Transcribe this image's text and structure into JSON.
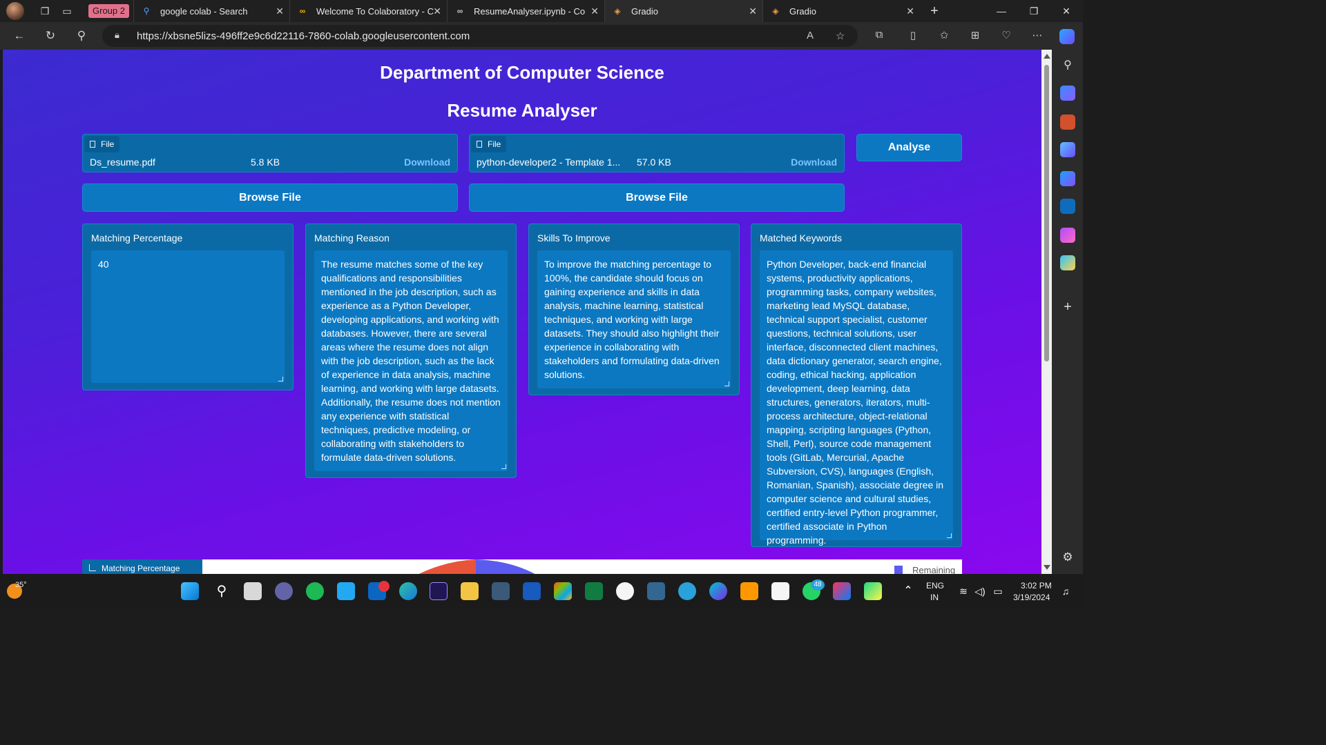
{
  "browser": {
    "tab_group": "Group 2",
    "tabs": [
      {
        "title": "google colab - Search",
        "icon": "search-icon"
      },
      {
        "title": "Welcome To Colaboratory - C",
        "icon": "colab-icon"
      },
      {
        "title": "ResumeAnalyser.ipynb - Colab",
        "icon": "colab-icon"
      },
      {
        "title": "Gradio",
        "icon": "gradio-icon",
        "active": true
      },
      {
        "title": "Gradio",
        "icon": "gradio-icon"
      }
    ],
    "url": "https://xbsne5lizs-496ff2e9c6d22116-7860-colab.googleusercontent.com"
  },
  "app": {
    "title": "Department of Computer Science",
    "subtitle": "Resume Analyser",
    "files": [
      {
        "chip": "File",
        "name": "Ds_resume.pdf",
        "size": "5.8 KB",
        "download": "Download"
      },
      {
        "chip": "File",
        "name": "python-developer2 - Template 1...",
        "size": "57.0 KB",
        "download": "Download"
      }
    ],
    "browse_label": "Browse File",
    "analyse_label": "Analyse",
    "panels": [
      {
        "label": "Matching Percentage",
        "value": "40"
      },
      {
        "label": "Matching Reason",
        "value": "The resume matches some of the key qualifications and responsibilities mentioned in the job description, such as experience as a Python Developer, developing applications, and working with databases. However, there are several areas where the resume does not align with the job description, such as the lack of experience in data analysis, machine learning, and working with large datasets. Additionally, the resume does not mention any experience with statistical techniques, predictive modeling, or collaborating with stakeholders to formulate data-driven solutions."
      },
      {
        "label": "Skills To Improve",
        "value": "To improve the matching percentage to 100%, the candidate should focus on gaining experience and skills in data analysis, machine learning, statistical techniques, and working with large datasets. They should also highlight their experience in collaborating with stakeholders and formulating data-driven solutions."
      },
      {
        "label": "Matched Keywords",
        "value": "Python Developer, back-end financial systems, productivity applications, programming tasks, company websites, marketing lead MySQL database, technical support specialist, customer questions, technical solutions, user interface, disconnected client machines, data dictionary generator, search engine, coding, ethical hacking, application development, deep learning, data structures, generators, iterators, multi-process architecture, object-relational mapping, scripting languages (Python, Shell, Perl), source code management tools (GitLab, Mercurial, Apache Subversion, CVS), languages (English, Romanian, Spanish), associate degree in computer science and cultural studies, certified entry-level Python programmer, certified associate in Python programming."
      }
    ],
    "chart_label": "Matching Percentage Chart",
    "chart_legend": "Remaining"
  },
  "taskbar": {
    "weather": "35°",
    "lang_top": "ENG",
    "lang_bottom": "IN",
    "time": "3:02 PM",
    "date": "3/19/2024",
    "whatsapp_badge": "48"
  },
  "colors": {
    "accent": "#0c78c2",
    "card": "#0b6aa6",
    "link": "#7ec3ff",
    "bg_start": "#3b2bd0",
    "bg_end": "#8a08ef"
  }
}
